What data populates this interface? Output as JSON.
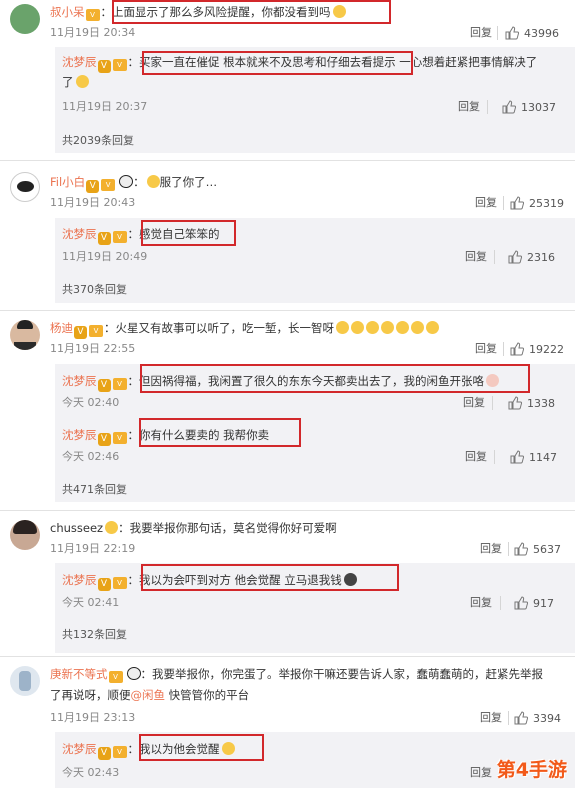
{
  "comments": [
    {
      "user": "叔小呆",
      "text": "上面显示了那么多风险提醒，你都没看到吗",
      "time": "11月19日 20:34",
      "reply": "回复",
      "likes": "43996",
      "replies": [
        {
          "user": "沈梦辰",
          "text": "买家一直在催促 根本就来不及思考和仔细去看提示 一心想着赶紧把事情解决了",
          "text_line2": "了",
          "time": "11月19日 20:37",
          "reply": "回复",
          "likes": "13037"
        }
      ],
      "more": "共2039条回复"
    },
    {
      "user": "Fil小白",
      "text": "服了你了…",
      "time": "11月19日 20:43",
      "reply": "回复",
      "likes": "25319",
      "replies": [
        {
          "user": "沈梦辰",
          "text": "感觉自己笨笨的",
          "time": "11月19日 20:49",
          "reply": "回复",
          "likes": "2316"
        }
      ],
      "more": "共370条回复"
    },
    {
      "user": "杨迪",
      "text": "火星又有故事可以听了，吃一堑，长一智呀",
      "time": "11月19日 22:55",
      "reply": "回复",
      "likes": "19222",
      "replies": [
        {
          "user": "沈梦辰",
          "text": "但因祸得福，我闲置了很久的东东今天都卖出去了，我的闲鱼开张咯",
          "time": "今天 02:40",
          "reply": "回复",
          "likes": "1338"
        },
        {
          "user": "沈梦辰",
          "text": "你有什么要卖的 我帮你卖",
          "time": "今天 02:46",
          "reply": "回复",
          "likes": "1147"
        }
      ],
      "more": "共471条回复"
    },
    {
      "user": "chusseez",
      "text": "我要举报你那句话，莫名觉得你好可爱啊",
      "time": "11月19日 22:19",
      "reply": "回复",
      "likes": "5637",
      "replies": [
        {
          "user": "沈梦辰",
          "text": "我以为会吓到对方 他会觉醒 立马退我钱",
          "time": "今天 02:41",
          "reply": "回复",
          "likes": "917"
        }
      ],
      "more": "共132条回复"
    },
    {
      "user": "庚新不等式",
      "text": "我要举报你，你完蛋了。举报你干嘛还要告诉人家，蠢萌蠢萌的，赶紧先举报",
      "text_line2a": "了再说呀，顺便",
      "text_mention": "@闲鱼",
      "text_line2b": " 快管管你的平台",
      "time": "11月19日 23:13",
      "reply": "回复",
      "likes": "3394",
      "replies": [
        {
          "user": "沈梦辰",
          "text": "我以为他会觉醒",
          "time": "今天 02:43",
          "reply": "回复",
          "likes": ""
        }
      ]
    }
  ],
  "watermark": "第4手游",
  "colors": {
    "username": "#eb7350",
    "highlight": "#d2282b",
    "reply_bg": "#f2f2f5"
  }
}
